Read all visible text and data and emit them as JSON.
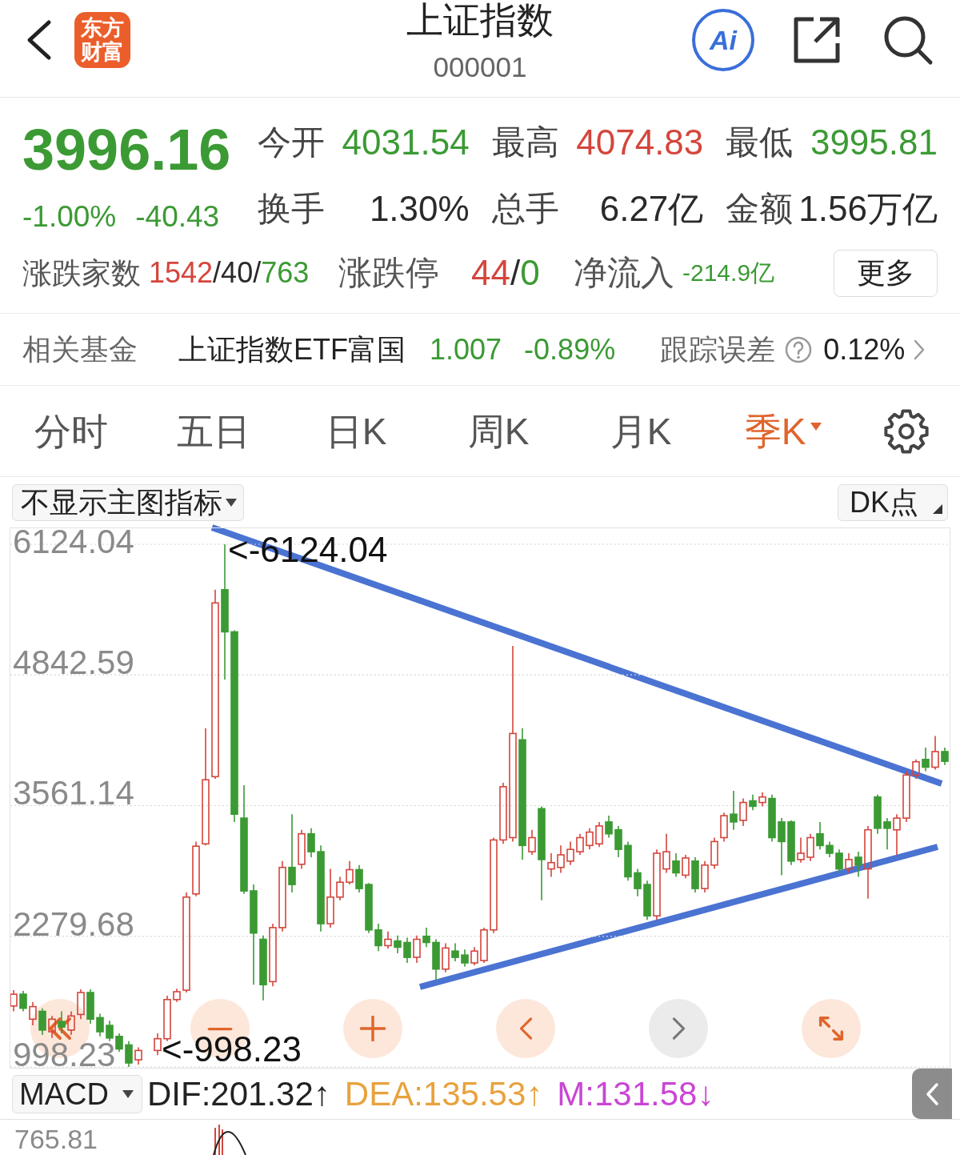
{
  "header": {
    "logo": "东方财富",
    "title": "上证指数",
    "code": "000001",
    "ai_label": "Ai"
  },
  "quote": {
    "price": "3996.16",
    "change_percent": "-1.00%",
    "change": "-40.43",
    "falling": true,
    "stats": [
      {
        "label": "今开",
        "value": "4031.54",
        "color": "#3b9a34"
      },
      {
        "label": "最高",
        "value": "4074.83",
        "color": "#d4453c"
      },
      {
        "label": "最低",
        "value": "3995.81",
        "color": "#3b9a34"
      },
      {
        "label": "换手",
        "value": "1.30%",
        "color": "#2a2a2a"
      },
      {
        "label": "总手",
        "value": "6.27亿",
        "color": "#2a2a2a"
      },
      {
        "label": "金额",
        "value": "1.56万亿",
        "color": "#2a2a2a"
      }
    ],
    "breadth": {
      "label": "涨跌家数",
      "parts": [
        {
          "text": "1542",
          "color": "#d4453c"
        },
        {
          "text": "/",
          "color": "#2a2a2a"
        },
        {
          "text": "40",
          "color": "#2a2a2a"
        },
        {
          "text": "/",
          "color": "#2a2a2a"
        },
        {
          "text": "763",
          "color": "#3b9a34"
        }
      ]
    },
    "limits": {
      "label": "涨跌停",
      "parts": [
        {
          "text": "44",
          "color": "#d4453c"
        },
        {
          "text": "/",
          "color": "#2a2a2a"
        },
        {
          "text": "0",
          "color": "#3b9a34"
        }
      ]
    },
    "net_inflow": {
      "label": "净流入",
      "value": "-214.9亿",
      "falling": true
    },
    "more_button": "更多"
  },
  "fund": {
    "label": "相关基金",
    "name": "上证指数ETF富国",
    "price": "1.007",
    "change": "-0.89%",
    "falling": true,
    "tracking_label": "跟踪误差",
    "tracking_value": "0.12%"
  },
  "tabs": [
    {
      "label": "分时",
      "selected": false,
      "has_menu": false
    },
    {
      "label": "五日",
      "selected": false,
      "has_menu": false
    },
    {
      "label": "日K",
      "selected": false,
      "has_menu": false
    },
    {
      "label": "周K",
      "selected": false,
      "has_menu": false
    },
    {
      "label": "月K",
      "selected": false,
      "has_menu": false
    },
    {
      "label": "季K",
      "selected": true,
      "has_menu": true
    }
  ],
  "chart": {
    "indicator_button": "不显示主图指标",
    "dk_button": "DK点",
    "chart_data": {
      "type": "candlestick",
      "ohlc": [
        [
          1597,
          1751,
          1544,
          1712
        ],
        [
          1712,
          1743,
          1544,
          1574
        ],
        [
          1467,
          1636,
          1406,
          1590
        ],
        [
          1544,
          1574,
          1313,
          1360
        ],
        [
          1344,
          1498,
          1283,
          1467
        ],
        [
          1444,
          1544,
          1329,
          1390
        ],
        [
          1360,
          1544,
          1313,
          1498
        ],
        [
          1513,
          1759,
          1467,
          1728
        ],
        [
          1728,
          1759,
          1421,
          1467
        ],
        [
          1482,
          1521,
          1298,
          1344
        ],
        [
          1406,
          1452,
          1252,
          1283
        ],
        [
          1298,
          1329,
          1145,
          1175
        ],
        [
          1214,
          1252,
          998.23,
          1037
        ],
        [
          1068,
          1191,
          1022,
          1160
        ],
        null,
        [
          1160,
          1329,
          1114,
          1275
        ],
        [
          1275,
          1697,
          1252,
          1659
        ],
        [
          1659,
          1766,
          1636,
          1736
        ],
        [
          1751,
          2710,
          1728,
          2664
        ],
        [
          2695,
          3209,
          2672,
          3163
        ],
        [
          3186,
          4321,
          3170,
          3815
        ],
        [
          3846,
          5679,
          3823,
          5549
        ],
        [
          5679,
          6124.04,
          4797,
          5265
        ],
        [
          5265,
          5280,
          3401,
          3477
        ],
        [
          3439,
          3761,
          2695,
          2725
        ],
        [
          2725,
          2787,
          1805,
          2311
        ],
        [
          2250,
          2288,
          1651,
          1805
        ],
        [
          1835,
          2403,
          1789,
          2365
        ],
        [
          2365,
          3017,
          2326,
          2955
        ],
        [
          2955,
          3477,
          2710,
          2787
        ],
        [
          2986,
          3324,
          2940,
          3285
        ],
        [
          3285,
          3339,
          3055,
          3109
        ],
        [
          3109,
          3170,
          2326,
          2403
        ],
        [
          2403,
          2940,
          2365,
          2664
        ],
        [
          2664,
          2863,
          2633,
          2810
        ],
        [
          2810,
          3017,
          2787,
          2933
        ],
        [
          2933,
          2978,
          2710,
          2748
        ],
        [
          2787,
          2802,
          2311,
          2342
        ],
        [
          2342,
          2403,
          2135,
          2188
        ],
        [
          2188,
          2326,
          2158,
          2250
        ],
        [
          2234,
          2288,
          2112,
          2173
        ],
        [
          2219,
          2265,
          2019,
          2073
        ],
        [
          2073,
          2288,
          2019,
          2250
        ],
        [
          2280,
          2365,
          2173,
          2219
        ],
        [
          2219,
          2250,
          1851,
          1958
        ],
        [
          1958,
          2211,
          1927,
          2165
        ],
        [
          2135,
          2211,
          2035,
          2073
        ],
        [
          2096,
          2150,
          1981,
          2019
        ],
        [
          2019,
          2173,
          1996,
          2135
        ],
        [
          2042,
          2365,
          2019,
          2342
        ],
        [
          2342,
          3247,
          2311,
          3224
        ],
        [
          3224,
          3784,
          3186,
          3746
        ],
        [
          3247,
          5127,
          3209,
          4268
        ],
        [
          4206,
          4321,
          3032,
          3170
        ],
        [
          3109,
          3324,
          3078,
          3247
        ],
        [
          3531,
          3554,
          2633,
          3032
        ],
        [
          2940,
          3094,
          2863,
          3002
        ],
        [
          2955,
          3170,
          2902,
          3078
        ],
        [
          3017,
          3209,
          2978,
          3132
        ],
        [
          3109,
          3285,
          3078,
          3247
        ],
        [
          3170,
          3339,
          3132,
          3301
        ],
        [
          3186,
          3401,
          3155,
          3362
        ],
        [
          3401,
          3462,
          3247,
          3285
        ],
        [
          3324,
          3362,
          3055,
          3132
        ],
        [
          3170,
          3209,
          2825,
          2863
        ],
        [
          2902,
          2940,
          2672,
          2748
        ],
        [
          2787,
          2825,
          2441,
          2480
        ],
        [
          2480,
          3132,
          2441,
          3094
        ],
        [
          2940,
          3285,
          2902,
          3109
        ],
        [
          3017,
          3094,
          2863,
          2902
        ],
        [
          2879,
          3078,
          2848,
          3048
        ],
        [
          3017,
          3055,
          2710,
          2748
        ],
        [
          2748,
          3017,
          2710,
          2978
        ],
        [
          2978,
          3247,
          2940,
          3209
        ],
        [
          3247,
          3493,
          3209,
          3462
        ],
        [
          3477,
          3707,
          3324,
          3401
        ],
        [
          3416,
          3631,
          3362,
          3592
        ],
        [
          3608,
          3669,
          3516,
          3554
        ],
        [
          3592,
          3692,
          3554,
          3646
        ],
        [
          3631,
          3669,
          3209,
          3247
        ],
        [
          3401,
          3439,
          2879,
          3209
        ],
        [
          3401,
          3416,
          2978,
          3017
        ],
        [
          3032,
          3247,
          3002,
          3094
        ],
        [
          3055,
          3285,
          3017,
          3247
        ],
        [
          3285,
          3401,
          3132,
          3170
        ],
        [
          3170,
          3209,
          3055,
          3094
        ],
        [
          3094,
          3132,
          2902,
          2940
        ],
        [
          2940,
          3094,
          2902,
          3032
        ],
        [
          3055,
          3109,
          2863,
          2978
        ],
        [
          2940,
          3362,
          2649,
          3324
        ],
        [
          3646,
          3669,
          3285,
          3339
        ],
        [
          3401,
          3439,
          3132,
          3339
        ],
        [
          3324,
          3477,
          3078,
          3439
        ],
        [
          3439,
          3899,
          3401,
          3861
        ],
        [
          3861,
          4014,
          3823,
          3991
        ],
        [
          4014,
          4130,
          3899,
          3938
        ],
        [
          3938,
          4245,
          3915,
          4091
        ],
        [
          4091,
          4130,
          3960,
          3996
        ]
      ],
      "ylim": [
        998.23,
        6124.04
      ],
      "yticks": [
        6124.04,
        4842.59,
        3561.14,
        2279.68,
        998.23
      ],
      "grid": true
    },
    "high_marker": "<-6124.04",
    "low_marker": "<-998.23",
    "controls": [
      {
        "kind": "jump_start",
        "disabled": false
      },
      {
        "kind": "zoom_out",
        "disabled": false
      },
      {
        "kind": "zoom_in",
        "disabled": false
      },
      {
        "kind": "prev",
        "disabled": false
      },
      {
        "kind": "next",
        "disabled": true
      },
      {
        "kind": "fullscreen",
        "disabled": false
      }
    ]
  },
  "macd": {
    "selector": "MACD",
    "values": [
      {
        "text": "DIF:201.32↑",
        "color": "#222222"
      },
      {
        "text": "DEA:135.53↑",
        "color": "#e8a23c"
      },
      {
        "text": "M:131.58↓",
        "color": "#c946d4"
      }
    ],
    "sub_tick": "765.81"
  }
}
